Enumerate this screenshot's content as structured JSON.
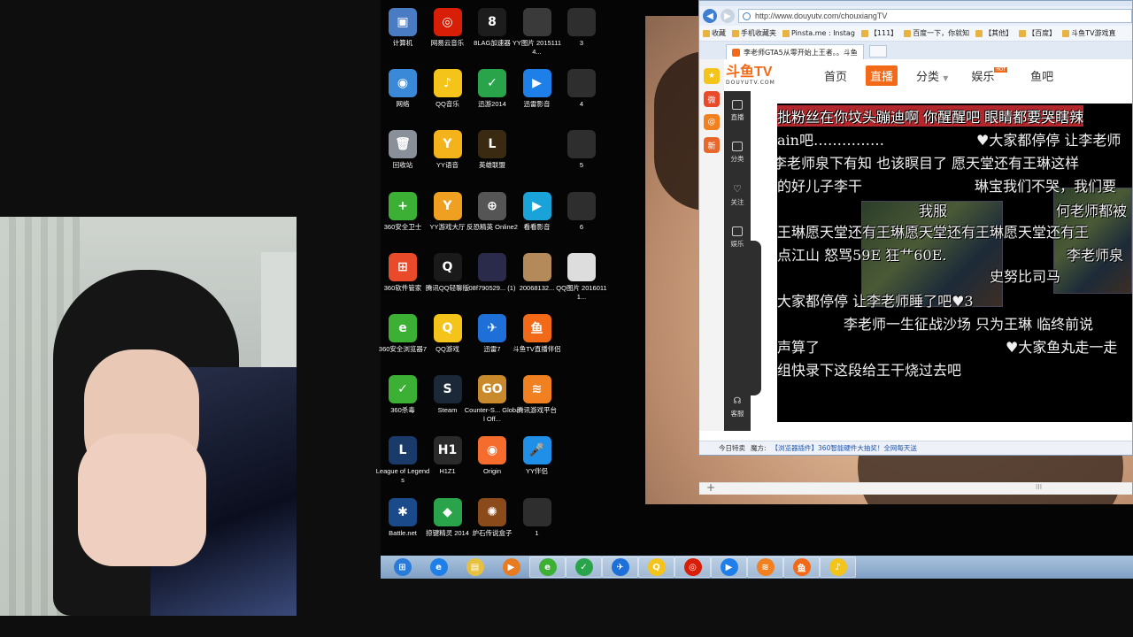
{
  "desktop": {
    "icons": [
      {
        "label": "计算机",
        "icon": "computer-icon",
        "color": "#4a7cc4",
        "glyph": "▣"
      },
      {
        "label": "网易云音乐",
        "icon": "netease-music-icon",
        "color": "#d81e06",
        "glyph": "◎"
      },
      {
        "label": "8LAG加速器",
        "icon": "8lag-accelerator-icon",
        "color": "#1d1d1d",
        "glyph": "8"
      },
      {
        "label": "YY图片 20151114...",
        "icon": "image-file-icon",
        "color": "#3a3a3a",
        "glyph": ""
      },
      {
        "label": "3",
        "icon": "image-file-icon",
        "color": "#2e2e2e",
        "glyph": ""
      },
      {
        "label": "网络",
        "icon": "network-icon",
        "color": "#3a88d8",
        "glyph": "◉"
      },
      {
        "label": "QQ音乐",
        "icon": "qq-music-icon",
        "color": "#f4c41a",
        "glyph": "♪"
      },
      {
        "label": "迅游2014",
        "icon": "xunyou-icon",
        "color": "#2aa44a",
        "glyph": "✓"
      },
      {
        "label": "迅雷影音",
        "icon": "xunlei-player-icon",
        "color": "#1f7fe8",
        "glyph": "▶"
      },
      {
        "label": "4",
        "icon": "image-file-icon",
        "color": "#2e2e2e",
        "glyph": ""
      },
      {
        "label": "回收站",
        "icon": "recycle-bin-icon",
        "color": "#8a9099",
        "glyph": "🗑"
      },
      {
        "label": "YY语音",
        "icon": "yy-voice-icon",
        "color": "#f4b31a",
        "glyph": "Y"
      },
      {
        "label": "英雄联盟",
        "icon": "league-icon",
        "color": "#3a2a12",
        "glyph": "L"
      },
      {
        "label": "5",
        "icon": "image-file-icon",
        "color": "#2e2e2e",
        "glyph": ""
      },
      {
        "label": "360安全卫士",
        "icon": "360-security-icon",
        "color": "#3cb034",
        "glyph": "+"
      },
      {
        "label": "YY游戏大厅",
        "icon": "yy-game-hall-icon",
        "color": "#f0a020",
        "glyph": "Y"
      },
      {
        "label": "反恐精英 Online2",
        "icon": "cso2-icon",
        "color": "#555",
        "glyph": "⊕"
      },
      {
        "label": "看看影音",
        "icon": "kankan-player-icon",
        "color": "#1aa3d8",
        "glyph": "▶"
      },
      {
        "label": "6",
        "icon": "image-file-icon",
        "color": "#2e2e2e",
        "glyph": ""
      },
      {
        "label": "360软件管家",
        "icon": "360-software-icon",
        "color": "#e84a2a",
        "glyph": "⊞"
      },
      {
        "label": "腾讯QQ轻聊版",
        "icon": "qq-icon",
        "color": "#1a1a1a",
        "glyph": "Q"
      },
      {
        "label": "08f790529... (1)",
        "icon": "image-file-icon",
        "color": "#2a2a4a",
        "glyph": ""
      },
      {
        "label": "20068132...",
        "icon": "image-file-icon",
        "color": "#b58a5a",
        "glyph": ""
      },
      {
        "label": "QQ图片 20160111...",
        "icon": "image-file-icon",
        "color": "#ddd",
        "glyph": ""
      },
      {
        "label": "360安全浏览器7",
        "icon": "360-browser-icon",
        "color": "#3cb034",
        "glyph": "e"
      },
      {
        "label": "QQ游戏",
        "icon": "qq-game-icon",
        "color": "#f4c41a",
        "glyph": "Q"
      },
      {
        "label": "迅雷7",
        "icon": "xunlei-icon",
        "color": "#1f6fd8",
        "glyph": "✈"
      },
      {
        "label": "斗鱼TV直播伴侣",
        "icon": "douyu-companion-icon",
        "color": "#f26a18",
        "glyph": "鱼"
      },
      {
        "label": "360杀毒",
        "icon": "360-antivirus-icon",
        "color": "#3cb034",
        "glyph": "✓"
      },
      {
        "label": "Steam",
        "icon": "steam-icon",
        "color": "#1b2838",
        "glyph": "S"
      },
      {
        "label": "Counter-S... Global Off...",
        "icon": "csgo-icon",
        "color": "#c88a2a",
        "glyph": "GO"
      },
      {
        "label": "腾讯游戏平台",
        "icon": "tencent-game-icon",
        "color": "#f08020",
        "glyph": "≋"
      },
      {
        "label": "League of Legends",
        "icon": "league-icon",
        "color": "#1a3a6a",
        "glyph": "L"
      },
      {
        "label": "H1Z1",
        "icon": "h1z1-icon",
        "color": "#2a2a2a",
        "glyph": "H1"
      },
      {
        "label": "Origin",
        "icon": "origin-icon",
        "color": "#f56c2d",
        "glyph": "◉"
      },
      {
        "label": "YY伴侣",
        "icon": "yy-companion-icon",
        "color": "#1f8fe8",
        "glyph": "🎤"
      },
      {
        "label": "Battle.net",
        "icon": "battlenet-icon",
        "color": "#1a4a8a",
        "glyph": "✱"
      },
      {
        "label": "掠键精灵 2014",
        "icon": "keyboard-sprite-icon",
        "color": "#2aa44a",
        "glyph": "◆"
      },
      {
        "label": "炉石传说盒子",
        "icon": "hearthstone-box-icon",
        "color": "#8a4a1a",
        "glyph": "✺"
      },
      {
        "label": "1",
        "icon": "image-file-icon",
        "color": "#2e2e2e",
        "glyph": ""
      }
    ]
  },
  "browser": {
    "url": "http://www.douyutv.com/chouxiangTV",
    "favorites": [
      "收藏",
      "手机收藏夹",
      "Pinsta.me : Instag",
      "【111】",
      "百度一下，你就知",
      "【其他】",
      "【百度】",
      "斗鱼TV游戏直"
    ],
    "tab_title": "李老师GTA5从零开始上王者。。斗鱼",
    "site": {
      "logo": "斗鱼TV",
      "logo_sub": "DOUYUTV.COM",
      "nav": [
        "首页",
        "直播",
        "分类",
        "娱乐",
        "鱼吧"
      ],
      "hot_badge": "HOT",
      "sidenav": [
        "直播",
        "分类",
        "关注",
        "娱乐"
      ],
      "sidenav_bottom": "客服"
    },
    "danmu": [
      "批粉丝在你坟头蹦迪啊 你醒醒吧 眼睛都要哭瞎辣",
      "ain吧……………",
      "♥大家都停停 让李老师",
      "李老师泉下有知 也该瞑目了 愿天堂还有王琳这样",
      "的好儿子李干",
      "琳宝我们不哭，我们要",
      "我服",
      "何老师都被",
      "王琳愿天堂还有王琳愿天堂还有王琳愿天堂还有王",
      "点江山 怒骂59E 狂艹60E.",
      "李老师泉",
      "史努比司马",
      "大家都停停 让李老师睡了吧♥3",
      "李老师一生征战沙场 只为王琳 临终前说",
      "声算了",
      "♥大家鱼丸走一走",
      "组快录下这段给王干烧过去吧"
    ],
    "status": {
      "today": "今日特卖",
      "promo_label": "魔方:",
      "promo_link": "【浏览器插件】360智能硬件大抽奖！全网每天送"
    },
    "scroll_glyph": "III"
  },
  "taskbar": {
    "items": [
      {
        "icon": "start-orb-icon",
        "color": "#2a7ad8",
        "glyph": "⊞"
      },
      {
        "icon": "ie-icon",
        "color": "#1f7fe8",
        "glyph": "e"
      },
      {
        "icon": "explorer-icon",
        "color": "#e8c040",
        "glyph": "▤"
      },
      {
        "icon": "media-player-icon",
        "color": "#e87a20",
        "glyph": "▶"
      },
      {
        "icon": "360-browser-icon",
        "color": "#3cb034",
        "glyph": "e"
      },
      {
        "icon": "xunyou-icon",
        "color": "#2aa44a",
        "glyph": "✓"
      },
      {
        "icon": "xunlei-icon",
        "color": "#1f6fd8",
        "glyph": "✈"
      },
      {
        "icon": "qq-game-icon",
        "color": "#f4c41a",
        "glyph": "Q"
      },
      {
        "icon": "netease-music-icon",
        "color": "#d81e06",
        "glyph": "◎"
      },
      {
        "icon": "xunlei-player-icon",
        "color": "#1f7fe8",
        "glyph": "▶"
      },
      {
        "icon": "tencent-game-icon",
        "color": "#f08020",
        "glyph": "≋"
      },
      {
        "icon": "douyu-companion-icon",
        "color": "#f26a18",
        "glyph": "鱼"
      },
      {
        "icon": "qq-music-icon",
        "color": "#f4c41a",
        "glyph": "♪"
      }
    ]
  }
}
